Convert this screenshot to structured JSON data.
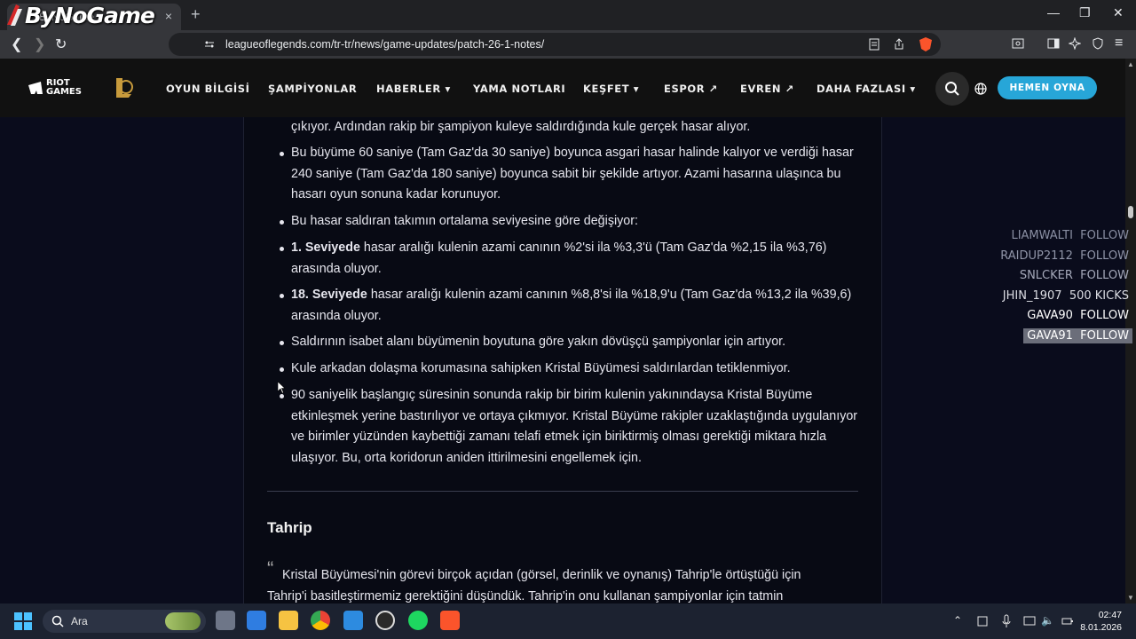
{
  "browser": {
    "tab_title": "ByNoGame",
    "tab_close": "×",
    "new_tab": "+",
    "url": "leagueoflegends.com/tr-tr/news/game-updates/patch-26-1-notes/"
  },
  "watermark": {
    "text": "ByNoGame"
  },
  "site_nav": {
    "riot_logo_text": "RIOT GAMES",
    "items": [
      {
        "label": "OYUN BİLGİSİ"
      },
      {
        "label": "ŞAMPİYONLAR"
      },
      {
        "label": "HABERLER ▾"
      },
      {
        "label": "YAMA NOTLARI"
      },
      {
        "label": "KEŞFET ▾"
      },
      {
        "label": "ESPOR ↗"
      },
      {
        "label": "EVREN ↗"
      },
      {
        "label": "DAHA FAZLASI ▾"
      }
    ],
    "play_button": "HEMEN OYNA"
  },
  "article": {
    "p0": "çıkıyor. Ardından rakip bir şampiyon kuleye saldırdığında kule gerçek hasar alıyor.",
    "b1": "Bu büyüme 60 saniye (Tam Gaz'da 30 saniye) boyunca asgari hasar halinde kalıyor ve verdiği hasar 240 saniye (Tam Gaz'da 180 saniye) boyunca sabit bir şekilde artıyor. Azami hasarına ulaşınca bu hasarı oyun sonuna kadar korunuyor.",
    "b2": "Bu hasar saldıran takımın ortalama seviyesine göre değişiyor:",
    "b3_bold": "1. Seviyede",
    "b3_rest": " hasar aralığı kulenin azami canının %2'si ila %3,3'ü (Tam Gaz'da %2,15 ila %3,76) arasında oluyor.",
    "b4_bold": "18. Seviyede",
    "b4_rest": " hasar aralığı kulenin azami canının %8,8'si ila %18,9'u (Tam Gaz'da %13,2 ila %39,6) arasında oluyor.",
    "b5": "Saldırının isabet alanı büyümenin boyutuna göre yakın dövüşçü şampiyonlar için artıyor.",
    "b6": "Kule arkadan dolaşma korumasına sahipken Kristal Büyümesi saldırılardan tetiklenmiyor.",
    "b7": "90 saniyelik başlangıç süresinin sonunda rakip bir birim kulenin yakınındaysa Kristal Büyüme etkinleşmek yerine bastırılıyor ve ortaya çıkmıyor. Kristal Büyüme rakipler uzaklaştığında uygulanıyor ve birimler yüzünden kaybettiği zamanı telafi etmek için biriktirmiş olması gerektiği miktara hızla ulaşıyor. Bu, orta koridorun aniden ittirilmesini engellemek için.",
    "heading": "Tahrip",
    "quote_mark": "“",
    "quote": "Kristal Büyümesi'nin görevi birçok açıdan (görsel, derinlik ve oynanış) Tahrip'le örtüştüğü için Tahrip'i basitleştirmemiz gerektiğini düşündük. Tahrip'in onu kullanan şampiyonlar için tatmin"
  },
  "stream_overlay": [
    {
      "name": "LIAMWALTI",
      "action": "FOLLOW",
      "opacity": 0.35
    },
    {
      "name": "RAIDUP2112",
      "action": "FOLLOW",
      "opacity": 0.45
    },
    {
      "name": "SNLCKER",
      "action": "FOLLOW",
      "opacity": 0.55
    },
    {
      "name": "JHIN_1907",
      "action": "500 KICKS",
      "opacity": 0.85
    },
    {
      "name": "GAVA90",
      "action": "FOLLOW",
      "opacity": 1
    },
    {
      "name": "GAVA91",
      "action": "FOLLOW",
      "opacity": 1
    }
  ],
  "taskbar": {
    "search_placeholder": "Ara",
    "time": "02:47",
    "date": "8.01.2026"
  },
  "colors": {
    "accent": "#27a6d8",
    "nav_bg": "#111111",
    "page_bg": "#0a0c1c"
  }
}
